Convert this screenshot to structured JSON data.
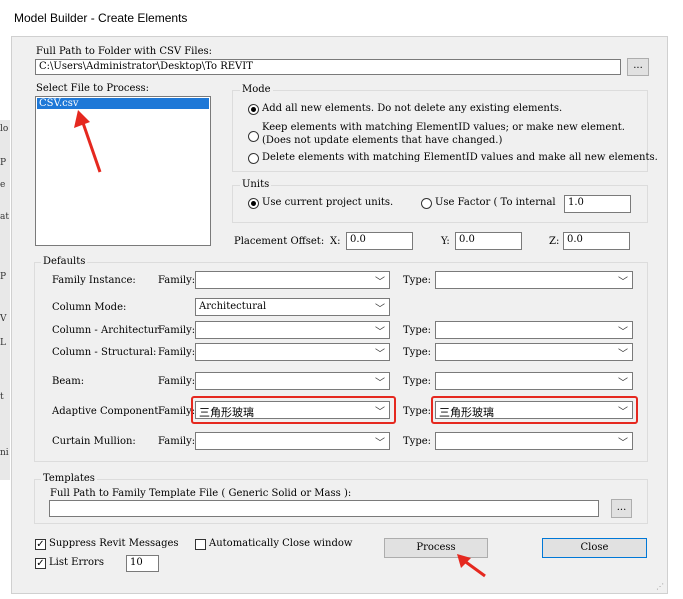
{
  "window": {
    "title": "Model Builder - Create Elements"
  },
  "left_strip_chars": [
    "lo",
    "P",
    "e",
    "at",
    "P",
    "V",
    "L",
    "t",
    "ni"
  ],
  "csv": {
    "label": "Full Path to Folder with CSV Files:",
    "path": "C:\\Users\\Administrator\\Desktop\\To REVIT",
    "browse": "..."
  },
  "file_select": {
    "label": "Select File to Process:",
    "items": [
      "CSV.csv"
    ]
  },
  "mode": {
    "title": "Mode",
    "options": [
      {
        "line1": "Add all new elements.  Do not delete any existing elements.",
        "line2": "",
        "checked": true
      },
      {
        "line1": "Keep elements with matching ElementID values; or make new element.",
        "line2": "(Does not update elements that have changed.)",
        "checked": false
      },
      {
        "line1": "Delete elements with matching ElementID values and make all new elements.",
        "line2": "",
        "checked": false
      }
    ]
  },
  "units": {
    "title": "Units",
    "opt_project": "Use current project units.",
    "opt_factor": "Use Factor ( To internal",
    "factor": "1.0",
    "project_checked": true
  },
  "placement": {
    "label": "Placement Offset:",
    "x_label": "X:",
    "x": "0.0",
    "y_label": "Y:",
    "y": "0.0",
    "z_label": "Z:",
    "z": "0.0"
  },
  "defaults": {
    "title": "Defaults",
    "family_label": "Family:",
    "type_label": "Type:",
    "rows": [
      {
        "label": "Family Instance:",
        "family": "",
        "type": "",
        "has_type": true
      },
      {
        "label": "Column Mode:",
        "family": "Architectural",
        "type": "",
        "has_type": false
      },
      {
        "label": "Column - Architectur",
        "family": "",
        "type": "",
        "has_type": true
      },
      {
        "label": "Column - Structural:",
        "family": "",
        "type": "",
        "has_type": true
      },
      {
        "label": "Beam:",
        "family": "",
        "type": "",
        "has_type": true
      },
      {
        "label": "Adaptive Component:",
        "family": "三角形玻璃",
        "type": "三角形玻璃",
        "has_type": true
      },
      {
        "label": "Curtain Mullion:",
        "family": "",
        "type": "",
        "has_type": true
      }
    ]
  },
  "templates": {
    "title": "Templates",
    "label": "Full Path to Family Template File ( Generic Solid or Mass ):",
    "path": "",
    "browse": "..."
  },
  "options": {
    "suppress": "Suppress Revit Messages",
    "suppress_checked": true,
    "auto_close": "Automatically Close window",
    "auto_close_checked": false,
    "list_errors": "List Errors",
    "list_errors_checked": true,
    "errors_count": "10"
  },
  "buttons": {
    "process": "Process",
    "close": "Close"
  },
  "colors": {
    "annotation": "#e5281f",
    "selection": "#1e78d7",
    "accent_border": "#0078d7"
  }
}
